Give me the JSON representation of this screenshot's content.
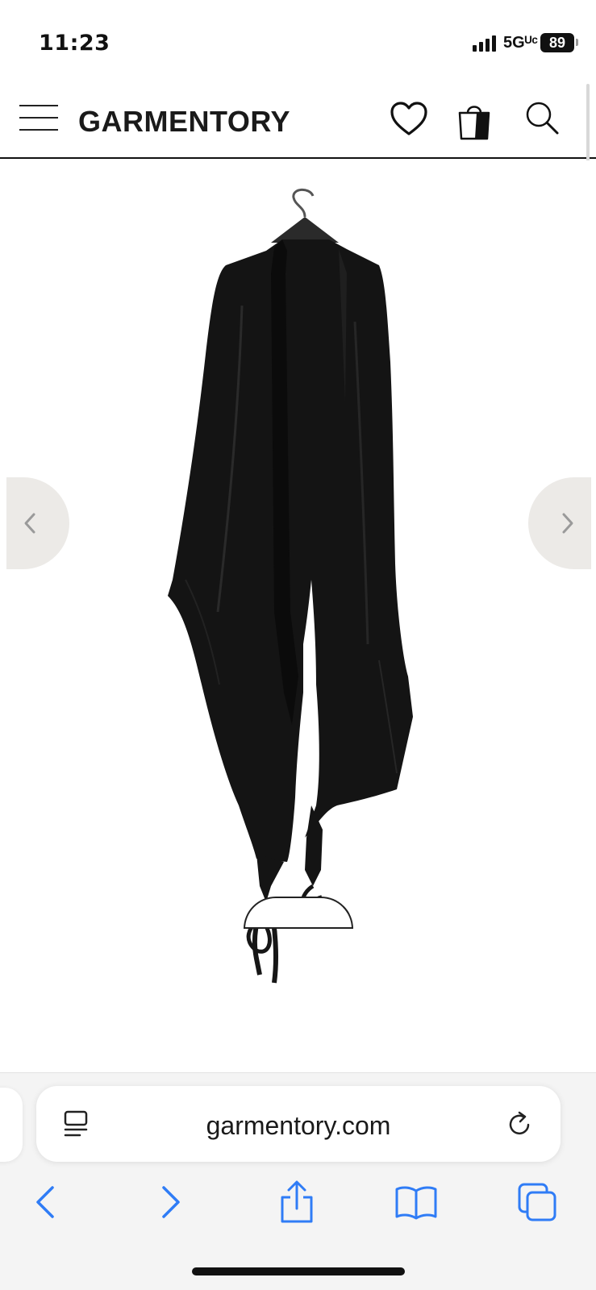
{
  "status_bar": {
    "time": "11:23",
    "network": "5Gᵁᶜ",
    "battery": "89"
  },
  "header": {
    "logo": "GARMENTORY",
    "icons": [
      "menu-icon",
      "heart-icon",
      "shopping-bag-icon",
      "search-icon"
    ]
  },
  "product": {
    "image_alt": "black draped jersey scarf on hanger"
  },
  "safari": {
    "url": "garmentory.com",
    "toolbar_icons": [
      "back-icon",
      "forward-icon",
      "share-icon",
      "bookmarks-icon",
      "tabs-icon"
    ],
    "accent_color": "#2f7cf6"
  },
  "colors": {
    "garment": "#141414",
    "arrow_bg": "#eceae7"
  }
}
